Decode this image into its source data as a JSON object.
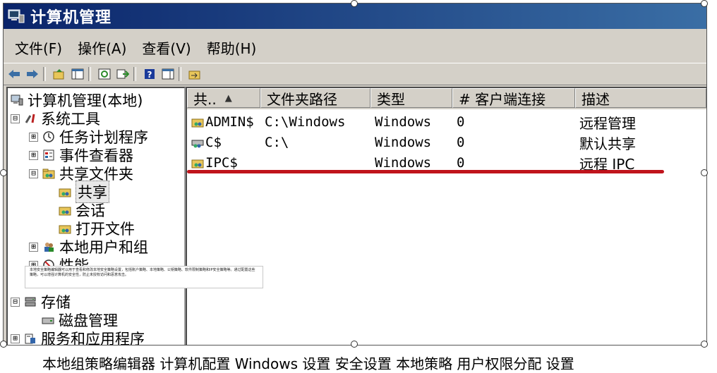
{
  "window": {
    "title": "计算机管理"
  },
  "menu": {
    "items": [
      "文件(F)",
      "操作(A)",
      "查看(V)",
      "帮助(H)"
    ]
  },
  "toolbar": {
    "buttons": [
      "back-icon",
      "forward-icon",
      "up-icon",
      "show-hide-tree-icon",
      "refresh-icon",
      "export-icon",
      "help-icon",
      "view-icon",
      "new-share-icon"
    ]
  },
  "tree": {
    "root": "计算机管理(本地)",
    "system_tools": "系统工具",
    "task_scheduler": "任务计划程序",
    "event_viewer": "事件查看器",
    "shared_folders": "共享文件夹",
    "shares": "共享",
    "sessions": "会话",
    "open_files": "打开文件",
    "local_users": "本地用户和组",
    "performance": "性能",
    "storage": "存储",
    "disk_management": "磁盘管理",
    "services_apps": "服务和应用程序",
    "expand_minus": "⊟",
    "expand_plus": "⊞"
  },
  "list": {
    "columns": [
      "共..",
      "文件夹路径",
      "类型",
      "# 客户端连接",
      "描述"
    ],
    "rows": [
      {
        "share": "ADMIN$",
        "path": "C:\\Windows",
        "type": "Windows",
        "clients": "0",
        "desc": "远程管理"
      },
      {
        "share": "C$",
        "path": "C:\\",
        "type": "Windows",
        "clients": "0",
        "desc": "默认共享"
      },
      {
        "share": "IPC$",
        "path": "",
        "type": "Windows",
        "clients": "0",
        "desc": "远程 IPC"
      }
    ]
  },
  "popup": {
    "text": "本地安全策略编辑器可以用于查看和修改本地安全策略设置，包括账户策略、本地策略、公钥策略、软件限制策略和IP安全策略等。通过配置这些策略，可以增强计算机的安全性，防止未授权访问和恶意攻击。"
  },
  "caption": {
    "text": "本地组策略编辑器 计算机配置 Windows 设置 安全设置 本地策略 用户权限分配 设置"
  },
  "colors": {
    "title_bar": "#0a246a",
    "window_bg": "#d4d0c8",
    "annotation_underline": "#c0141c"
  }
}
